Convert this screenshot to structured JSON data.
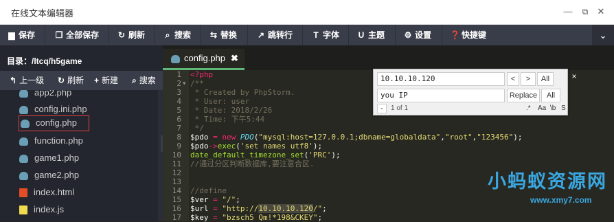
{
  "window": {
    "title": "在线文本编辑器",
    "controls": [
      "minimize-icon",
      "restore-icon",
      "close-icon"
    ]
  },
  "toolbar": {
    "items": [
      {
        "icon": "save-icon",
        "glyph": "▆",
        "label": "保存"
      },
      {
        "icon": "save-all-icon",
        "glyph": "❐",
        "label": "全部保存"
      },
      {
        "icon": "refresh-icon",
        "glyph": "↻",
        "label": "刷新"
      },
      {
        "icon": "search-icon",
        "glyph": "⌕",
        "label": "搜索"
      },
      {
        "icon": "replace-icon",
        "glyph": "⇆",
        "label": "替换"
      },
      {
        "icon": "goto-line-icon",
        "glyph": "↗",
        "label": "跳转行"
      },
      {
        "icon": "font-icon",
        "glyph": "T",
        "label": "字体"
      },
      {
        "icon": "theme-icon",
        "glyph": "U",
        "label": "主题"
      },
      {
        "icon": "settings-icon",
        "glyph": "⚙",
        "label": "设置"
      },
      {
        "icon": "shortcut-icon",
        "glyph": "❓",
        "label": "快捷键"
      }
    ],
    "more_icon": "chevron-down-icon"
  },
  "sidebar": {
    "directory_label": "目录：/ltcq/h5game",
    "actions": [
      {
        "icon": "up-arrow-icon",
        "glyph": "↰",
        "label": "上一级"
      },
      {
        "icon": "refresh-icon",
        "glyph": "↻",
        "label": "刷新"
      },
      {
        "icon": "plus-icon",
        "glyph": "+",
        "label": "新建"
      },
      {
        "icon": "search-icon",
        "glyph": "⌕",
        "label": "搜索"
      }
    ],
    "files": [
      {
        "name": "app2.php",
        "type": "php"
      },
      {
        "name": "config.ini.php",
        "type": "php"
      },
      {
        "name": "config.php",
        "type": "php",
        "selected": true
      },
      {
        "name": "function.php",
        "type": "php"
      },
      {
        "name": "game1.php",
        "type": "php"
      },
      {
        "name": "game2.php",
        "type": "php"
      },
      {
        "name": "index.html",
        "type": "html"
      },
      {
        "name": "index.js",
        "type": "js"
      }
    ],
    "collapse_icon": "chevron-left-icon"
  },
  "editor": {
    "tab": {
      "label": "config.php",
      "close_glyph": "✖"
    },
    "line_numbers": [
      "1",
      "2",
      "3",
      "4",
      "5",
      "6",
      "7",
      "8",
      "9",
      "10",
      "11",
      "12",
      "13",
      "14",
      "15",
      "16",
      "17"
    ],
    "lines": {
      "l1_open": "<?php",
      "l2": "/**",
      "l3": " * Created by PhpStorm.",
      "l4": " * User: user",
      "l5": " * Date: 2018/2/26",
      "l6": " * Time: 下午5:44",
      "l7": " */",
      "l8_var": "$pdo",
      "l8_eq": " = ",
      "l8_new": "new ",
      "l8_cls": "PDO",
      "l8_args_open": "(",
      "l8_s1": "\"mysql:host=127.0.0.1;dbname=globaldata\"",
      "l8_c1": ",",
      "l8_s2": "\"root\"",
      "l8_c2": ",",
      "l8_s3": "\"123456\"",
      "l8_close": ");",
      "l9_var": "$pdo",
      "l9_arrow": "->",
      "l9_fn": "exec",
      "l9_open": "(",
      "l9_s": "'set names utf8'",
      "l9_close": ");",
      "l10_fn": "date_default_timezone_set",
      "l10_open": "(",
      "l10_s": "'PRC'",
      "l10_close": ");",
      "l11": "//通过分区判断数据库,要注意合区.",
      "l12": "",
      "l13": "",
      "l14": "//define",
      "l15_var": "$ver",
      "l15_eq": " = ",
      "l15_s": "\"/\"",
      "l15_end": ";",
      "l16_var": "$url",
      "l16_eq": " = ",
      "l16_s_a": "\"http://",
      "l16_s_hl": "10.10.10.120",
      "l16_s_b": "/\"",
      "l16_end": ";",
      "l17_var": "$key",
      "l17_eq": " = ",
      "l17_s": "\"bzsch5_Qm!*198&CKEY\"",
      "l17_end": ";"
    }
  },
  "search": {
    "find_value": "10.10.10.120",
    "prev_glyph": "<",
    "next_glyph": ">",
    "all_label": "All",
    "replace_value": "you IP",
    "replace_label": "Replace",
    "replace_all_label": "All",
    "minus_glyph": "-",
    "counter": "1 of 1",
    "regex_label": ".*",
    "case_label": "Aa",
    "word_label": "\\b",
    "selection_label": "S",
    "close_glyph": "×"
  },
  "watermark": {
    "title": "小蚂蚁资源网",
    "url": "www.xmy7.com"
  }
}
